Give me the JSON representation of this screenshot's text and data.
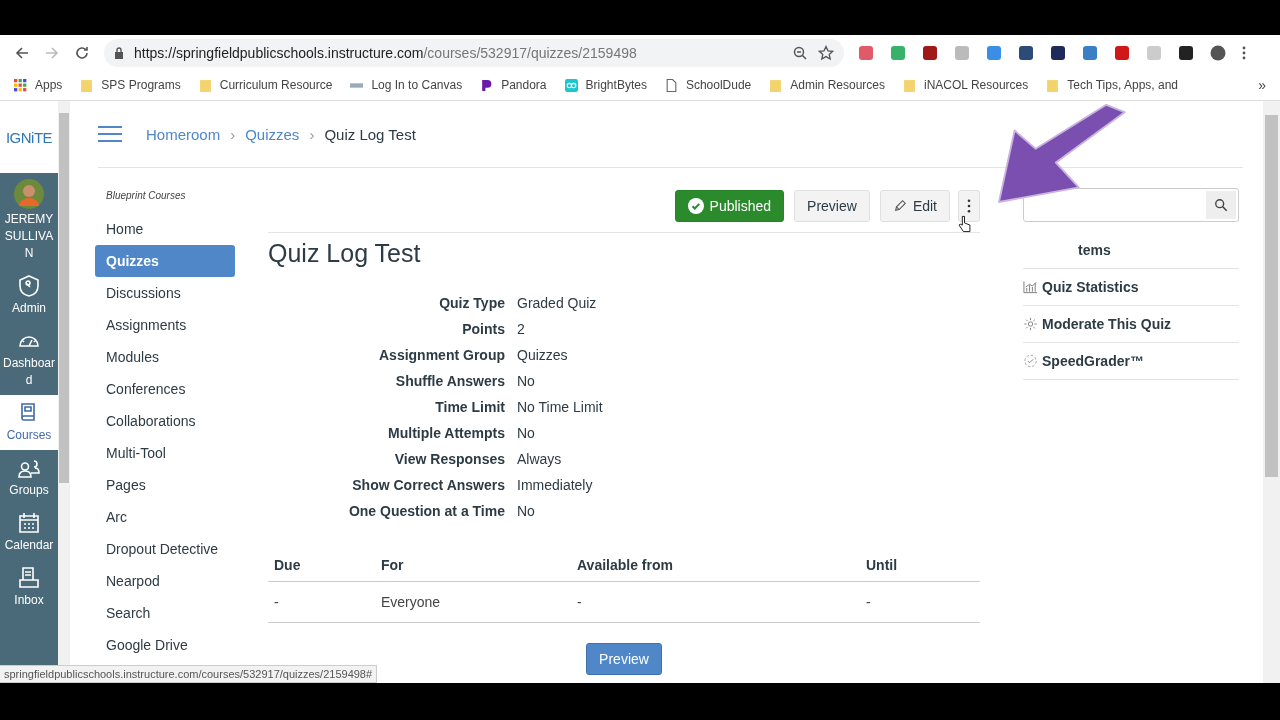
{
  "browser": {
    "url_host": "https://springfieldpublicschools.instructure.com",
    "url_path": "/courses/532917/quizzes/2159498",
    "bookmarks": [
      {
        "label": "Apps",
        "kind": "apps"
      },
      {
        "label": "SPS Programs",
        "kind": "folder"
      },
      {
        "label": "Curriculum Resource",
        "kind": "folder"
      },
      {
        "label": "Log In to Canvas",
        "kind": "site"
      },
      {
        "label": "Pandora",
        "kind": "pandora"
      },
      {
        "label": "BrightBytes",
        "kind": "bright"
      },
      {
        "label": "SchoolDude",
        "kind": "page"
      },
      {
        "label": "Admin Resources",
        "kind": "folder"
      },
      {
        "label": "iNACOL Resources",
        "kind": "folder"
      },
      {
        "label": "Tech Tips, Apps, and",
        "kind": "folder"
      }
    ],
    "more_bookmarks": "»"
  },
  "global_nav": {
    "logo": "IGNiTE",
    "user": "JEREMY SULLIVAN",
    "items": [
      {
        "label": "Admin",
        "kind": "admin",
        "selected": false
      },
      {
        "label": "Dashboard",
        "kind": "dashboard",
        "selected": false
      },
      {
        "label": "Courses",
        "kind": "courses",
        "selected": true
      },
      {
        "label": "Groups",
        "kind": "groups",
        "selected": false
      },
      {
        "label": "Calendar",
        "kind": "calendar",
        "selected": false
      },
      {
        "label": "Inbox",
        "kind": "inbox",
        "selected": false
      }
    ]
  },
  "breadcrumb": {
    "separator": "›",
    "items": [
      "Homeroom",
      "Quizzes",
      "Quiz Log Test"
    ]
  },
  "course_nav": {
    "heading": "Blueprint Courses",
    "items": [
      {
        "label": "Home",
        "selected": false
      },
      {
        "label": "Quizzes",
        "selected": true
      },
      {
        "label": "Discussions",
        "selected": false
      },
      {
        "label": "Assignments",
        "selected": false
      },
      {
        "label": "Modules",
        "selected": false
      },
      {
        "label": "Conferences",
        "selected": false
      },
      {
        "label": "Collaborations",
        "selected": false
      },
      {
        "label": "Multi-Tool",
        "selected": false
      },
      {
        "label": "Pages",
        "selected": false
      },
      {
        "label": "Arc",
        "selected": false
      },
      {
        "label": "Dropout Detective",
        "selected": false
      },
      {
        "label": "Nearpod",
        "selected": false
      },
      {
        "label": "Search",
        "selected": false
      },
      {
        "label": "Google Drive",
        "selected": false
      }
    ]
  },
  "quiz": {
    "publish": {
      "label": "Published",
      "published": true
    },
    "preview_label": "Preview",
    "edit_label": "Edit",
    "title": "Quiz Log Test",
    "details": [
      {
        "label": "Quiz Type",
        "value": "Graded Quiz"
      },
      {
        "label": "Points",
        "value": "2"
      },
      {
        "label": "Assignment Group",
        "value": "Quizzes"
      },
      {
        "label": "Shuffle Answers",
        "value": "No"
      },
      {
        "label": "Time Limit",
        "value": "No Time Limit"
      },
      {
        "label": "Multiple Attempts",
        "value": "No"
      },
      {
        "label": "View Responses",
        "value": "Always"
      },
      {
        "label": "Show Correct Answers",
        "value": "Immediately"
      },
      {
        "label": "One Question at a Time",
        "value": "No"
      }
    ],
    "table": {
      "columns": [
        "Due",
        "For",
        "Available from",
        "Until"
      ],
      "rows": [
        [
          "-",
          "Everyone",
          "-",
          "-"
        ]
      ]
    },
    "bottom_button": "Preview"
  },
  "sidebar": {
    "items": [
      {
        "label": "tems",
        "kind": "none"
      },
      {
        "label": "Quiz Statistics",
        "kind": "stats"
      },
      {
        "label": "Moderate This Quiz",
        "kind": "gear"
      },
      {
        "label": "SpeedGrader™",
        "kind": "check"
      }
    ]
  },
  "status_url": "springfieldpublicschools.instructure.com/courses/532917/quizzes/2159498#"
}
